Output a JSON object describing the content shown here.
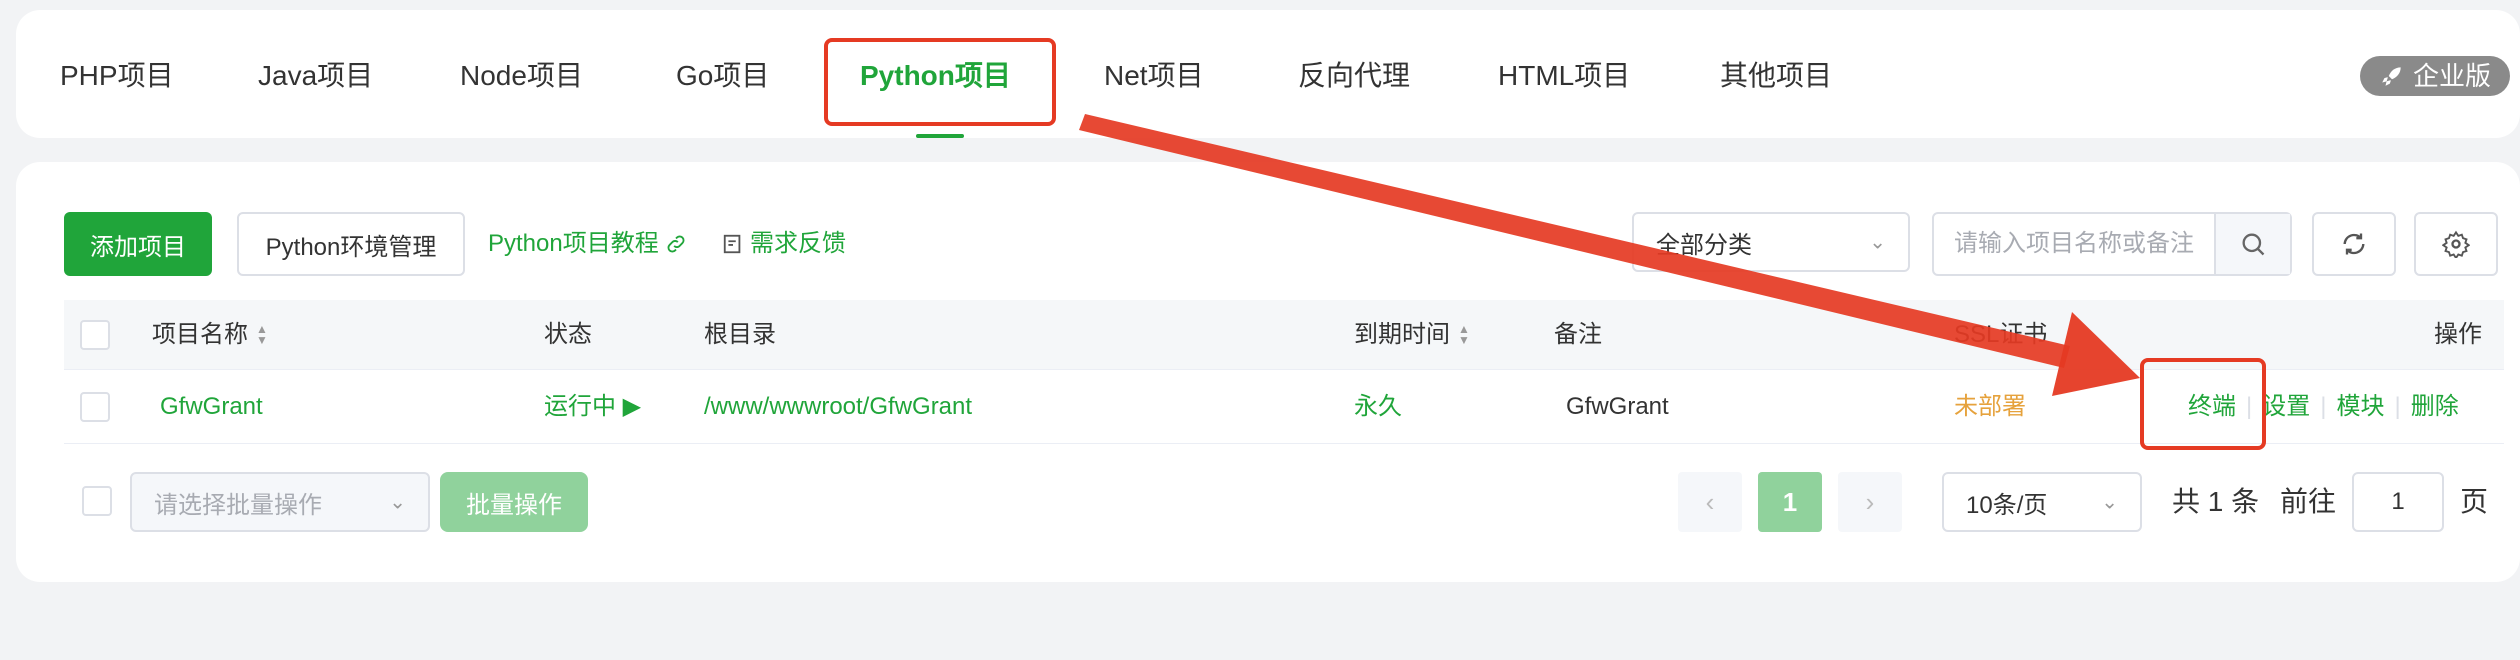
{
  "tabs": [
    {
      "label": "PHP项目"
    },
    {
      "label": "Java项目"
    },
    {
      "label": "Node项目"
    },
    {
      "label": "Go项目"
    },
    {
      "label": "Python项目",
      "active": true
    },
    {
      "label": "Net项目"
    },
    {
      "label": "反向代理"
    },
    {
      "label": "HTML项目"
    },
    {
      "label": "其他项目"
    }
  ],
  "enterprise_badge": "企业版",
  "toolbar": {
    "add_label": "添加项目",
    "env_label": "Python环境管理",
    "tutorial_link": "Python项目教程",
    "feedback_link": "需求反馈",
    "category_value": "全部分类",
    "search_placeholder": "请输入项目名称或备注"
  },
  "table": {
    "headers": {
      "name": "项目名称",
      "status": "状态",
      "root": "根目录",
      "expire": "到期时间",
      "remark": "备注",
      "ssl": "SSL证书",
      "actions": "操作"
    },
    "rows": [
      {
        "name": "GfwGrant",
        "status": "运行中",
        "root": "/www/wwwroot/GfwGrant",
        "expire": "永久",
        "remark": "GfwGrant",
        "ssl": "未部署",
        "actions": [
          "终端",
          "设置",
          "模块",
          "删除"
        ]
      }
    ]
  },
  "footer": {
    "batch_placeholder": "请选择批量操作",
    "batch_button": "批量操作",
    "current_page": "1",
    "page_size": "10条/页",
    "total_text": "共 1 条",
    "goto_label": "前往",
    "goto_value": "1",
    "page_suffix": "页"
  },
  "colors": {
    "accent": "#20a53a",
    "annotation": "#e53a23",
    "warning": "#e6a23c"
  }
}
